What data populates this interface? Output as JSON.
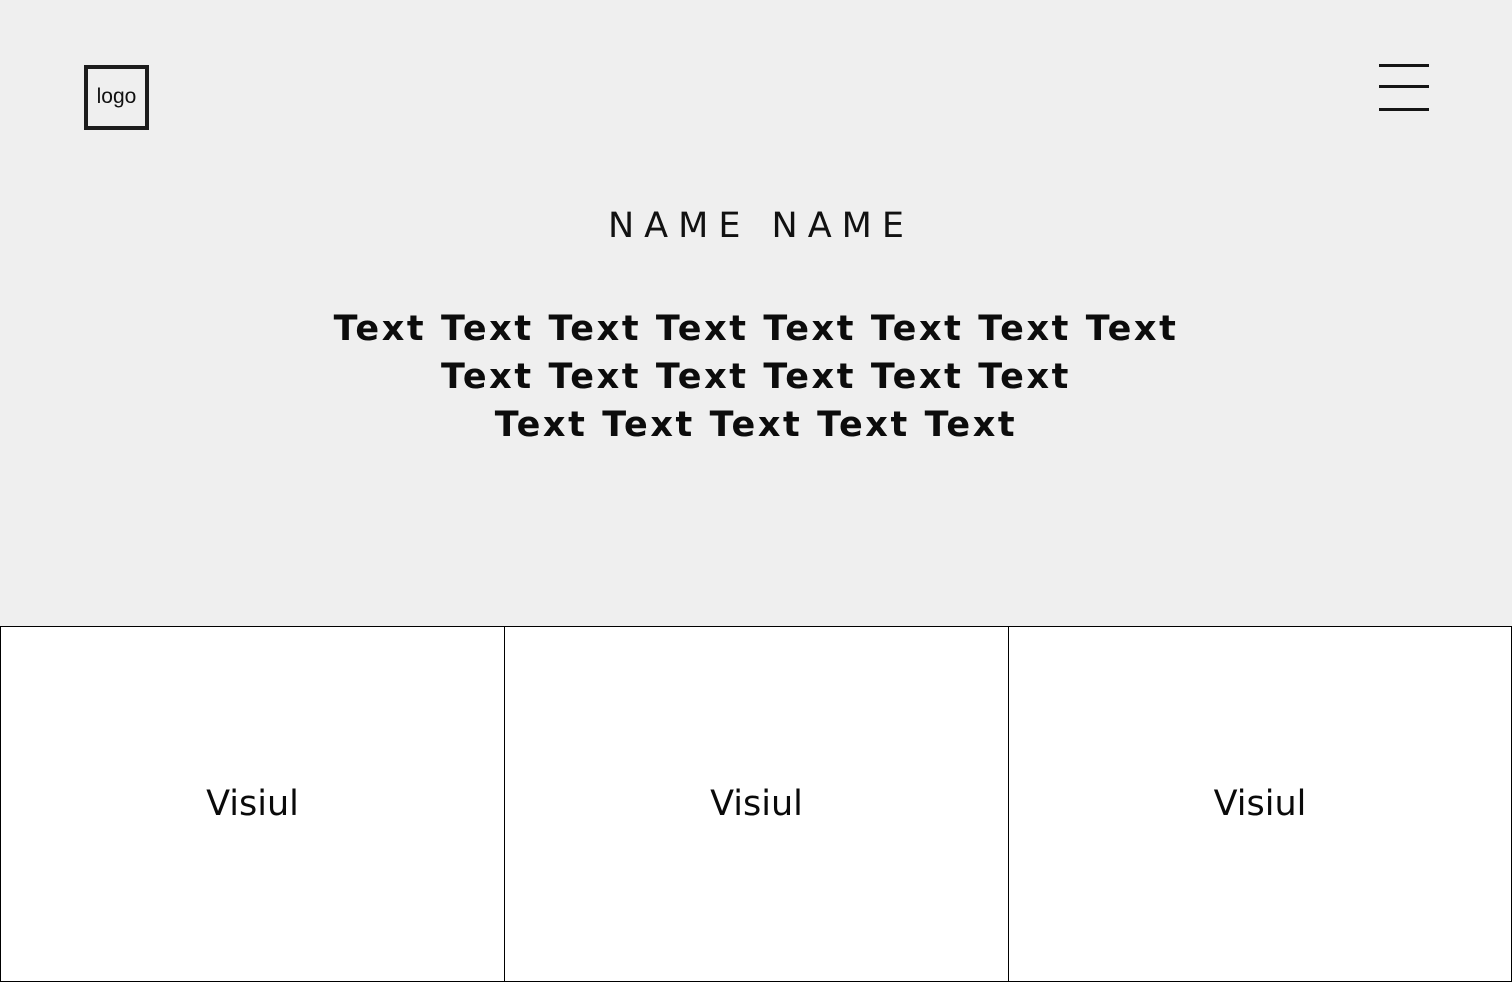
{
  "header": {
    "logo_text": "logo",
    "menu_icon": "hamburger-menu-icon"
  },
  "hero": {
    "title": "NAME NAME",
    "text_lines": [
      "Text Text Text Text Text Text Text Text",
      "Text Text Text Text Text Text",
      "Text Text Text Text Text"
    ]
  },
  "tiles": [
    {
      "label": "Visiul"
    },
    {
      "label": "Visiul"
    },
    {
      "label": "Visiul"
    }
  ],
  "colors": {
    "hero_background": "#efefef",
    "tile_background": "#ffffff",
    "text": "#0a0a0a",
    "border": "#000000"
  }
}
